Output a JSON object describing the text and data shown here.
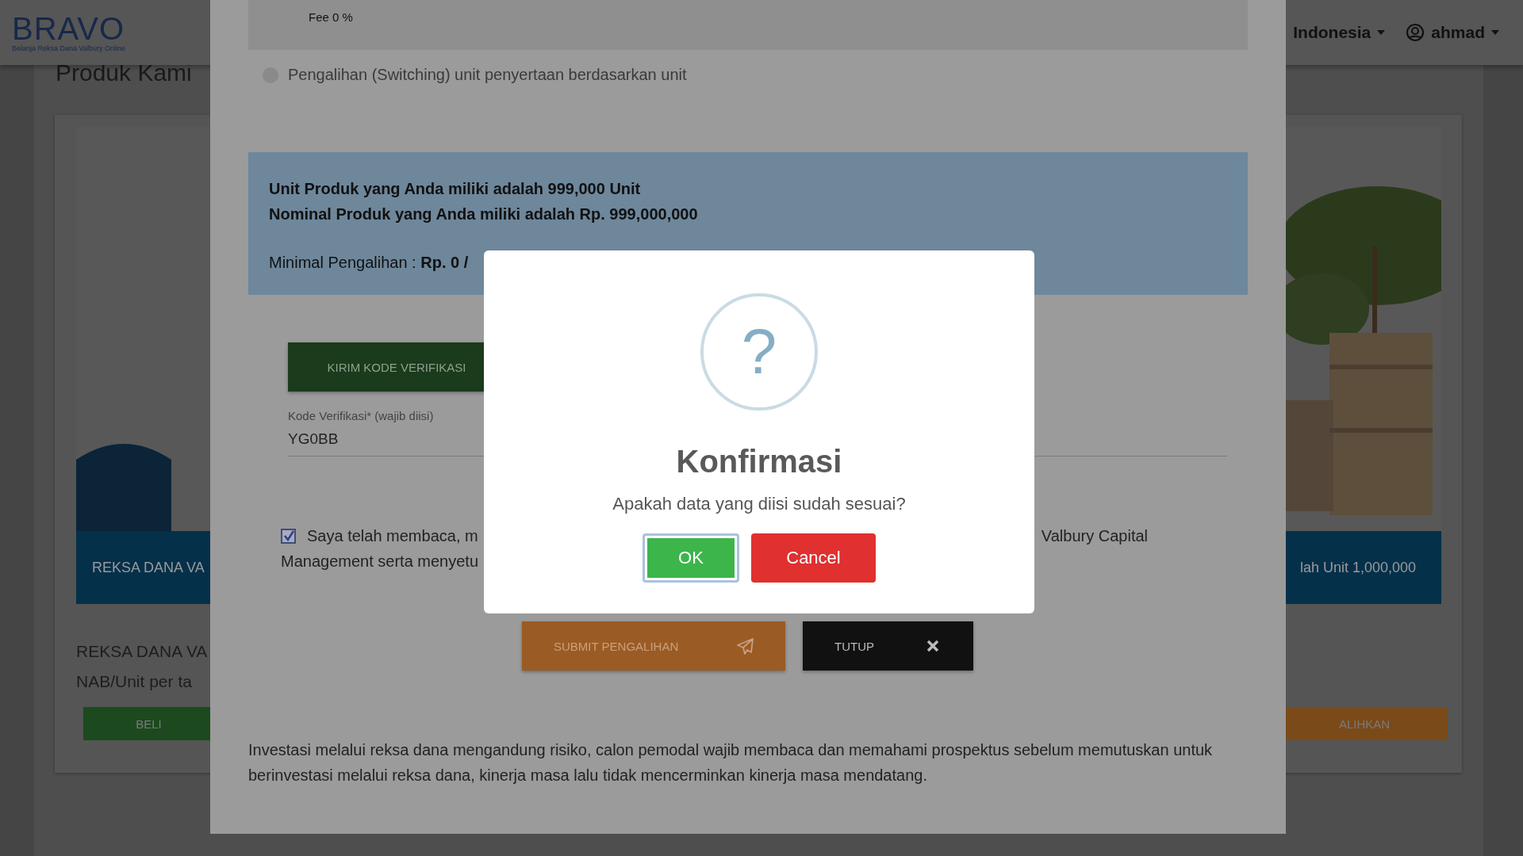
{
  "header": {
    "logo": {
      "name": "BRAVO",
      "tagline": "Belanja Reksa Dana Valbury Online"
    },
    "language": "Indonesia",
    "user": "ahmad"
  },
  "page": {
    "title": "Produk Kami",
    "product_card": {
      "banner": {
        "kind": "picture",
        "bar_left": "REKSA DANA VA",
        "bar_right": "lah Unit 1,000,000"
      },
      "name": "REKSA DANA VA",
      "nav_label": "NAB/Unit per ta",
      "buttons": [
        {
          "label": "BELI",
          "kind": "buy"
        },
        {
          "label": "ALIHKAN",
          "kind": "switch"
        }
      ]
    }
  },
  "modal": {
    "fee": "Fee 0 %",
    "radio": {
      "label": "Pengalihan (Switching) unit penyertaan berdasarkan unit",
      "selected": false
    },
    "info": {
      "lines": [
        "Unit Produk yang Anda miliki adalah 999,000 Unit",
        "Nominal Produk yang Anda miliki adalah Rp. 999,000,000"
      ],
      "minimum": "Minimal Pengalihan : **Rp. 0 /**"
    },
    "send_code_button": "KIRIM KODE VERIFIKASI",
    "code_field": {
      "label": "Kode Verifikasi* (wajib diisi)",
      "value": "YG0BB"
    },
    "agreement": {
      "checked": true,
      "line_1_left": "Saya telah membaca, m",
      "line_1_right": "Valbury Capital",
      "line_2": "Management serta menyetu"
    },
    "buttons": [
      {
        "label": "SUBMIT PENGALIHAN",
        "kind": "submit"
      },
      {
        "label": "TUTUP",
        "kind": "close"
      }
    ],
    "disclaimer": "Investasi melalui reksa dana mengandung risiko, calon pemodal wajib membaca dan memahami prospektus sebelum memutuskan untuk berinvestasi melalui reksa dana, kinerja masa lalu tidak mencerminkan kinerja masa mendatang."
  },
  "dialog": {
    "icon": "?",
    "title": "Konfirmasi",
    "message": "Apakah data yang diisi sudah sesuai?",
    "buttons": [
      {
        "label": "OK",
        "kind": "confirm",
        "focused": true
      },
      {
        "label": "Cancel",
        "kind": "cancel",
        "focused": false
      }
    ]
  }
}
